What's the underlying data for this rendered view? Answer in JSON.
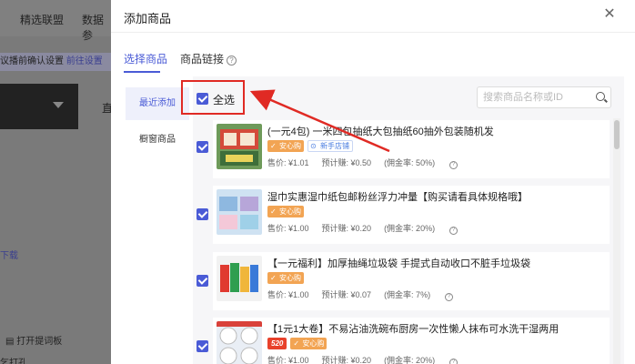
{
  "background": {
    "nav_items": [
      "精选联盟",
      "数据参"
    ],
    "notice_text": "议播前确认设置",
    "notice_link": "前往设置",
    "side_letter": "直",
    "download_text": "下载",
    "open_text": "打开提词板",
    "bottom_text": "乞打孔..."
  },
  "modal": {
    "title": "添加商品",
    "close_icon": "close-icon",
    "tabs": [
      {
        "label": "选择商品",
        "active": true
      },
      {
        "label": "商品链接",
        "active": false
      }
    ],
    "left_menu": [
      {
        "label": "最近添加",
        "active": true
      },
      {
        "label": "橱窗商品",
        "active": false
      }
    ],
    "select_all_label": "全选",
    "search_placeholder": "搜索商品名称或ID",
    "products": [
      {
        "title": "(一元4包) 一米四包抽纸大包抽纸60抽外包装随机发",
        "badges": [
          {
            "type": "orange",
            "text": "安心购"
          },
          {
            "type": "blue",
            "text": "新手店铺"
          }
        ],
        "price": "售价: ¥1.01",
        "earn": "预计赚: ¥0.50",
        "commission": "(佣金率: 50%)"
      },
      {
        "title": "湿巾实惠湿巾纸包邮粉丝浮力冲量【购买请看具体规格哦】",
        "badges": [
          {
            "type": "orange",
            "text": "安心购"
          }
        ],
        "price": "售价: ¥1.00",
        "earn": "预计赚: ¥0.20",
        "commission": "(佣金率: 20%)"
      },
      {
        "title": "【一元福利】加厚抽绳垃圾袋 手提式自动收口不脏手垃圾袋",
        "badges": [
          {
            "type": "orange",
            "text": "安心购"
          }
        ],
        "price": "售价: ¥1.00",
        "earn": "预计赚: ¥0.07",
        "commission": "(佣金率: 7%)"
      },
      {
        "title": "【1元1大卷】不易沾油洗碗布厨房一次性懒人抹布可水洗干湿两用",
        "badges": [
          {
            "type": "red",
            "text": "520"
          },
          {
            "type": "orange",
            "text": "安心购"
          }
        ],
        "price": "售价: ¥1.00",
        "earn": "预计赚: ¥0.20",
        "commission": "(佣金率: 20%)"
      }
    ]
  },
  "colors": {
    "accent": "#4a5bd6",
    "annotation": "#e02a24",
    "badge_orange": "#f2a453"
  }
}
